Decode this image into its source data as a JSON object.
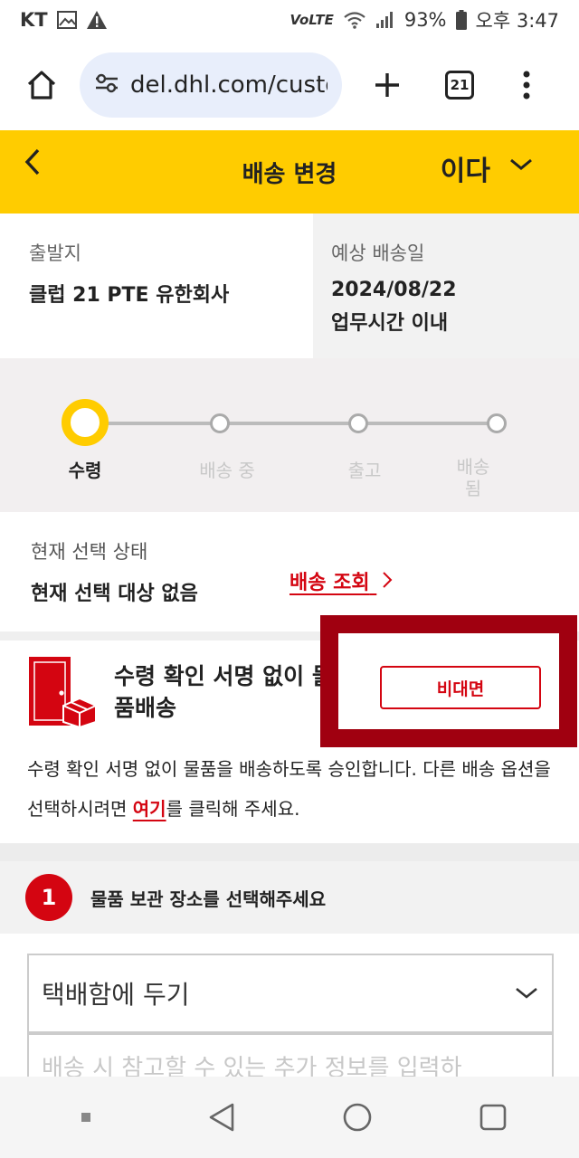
{
  "status_bar": {
    "carrier": "KT",
    "network": "VoLTE",
    "battery": "93%",
    "time": "오후 3:47"
  },
  "browser": {
    "url": "del.dhl.com/custo",
    "tab_count": "21"
  },
  "header": {
    "title": "배송 변경",
    "language": "이다"
  },
  "info": {
    "origin_label": "출발지",
    "origin_value": "클럽 21 PTE 유한회사",
    "eta_label": "예상 배송일",
    "eta_date": "2024/08/22",
    "eta_time": "업무시간 이내"
  },
  "progress": {
    "steps": [
      "수령",
      "배송 중",
      "출고",
      "배송 됨"
    ],
    "active_index": 0
  },
  "current": {
    "label": "현재 선택 상태",
    "value": "현재 선택 대상 없음",
    "track_link": "배송 조회"
  },
  "option": {
    "title": "수령 확인 서명 없이 물품배송",
    "button": "비대면",
    "desc_before": "수령 확인 서명 없이 물품을 배송하도록 승인합니다. 다른 배송 옵션을 선택하시려면 ",
    "desc_link": "여기",
    "desc_after": "를 클릭해 주세요."
  },
  "step1": {
    "number": "1",
    "title": "물품 보관 장소를 선택해주세요",
    "select_value": "택배함에 두기",
    "textarea_placeholder": "배송 시 참고할 수 있는 추가 정보를 입력하"
  },
  "colors": {
    "brand_yellow": "#ffcc00",
    "brand_red": "#d40511",
    "highlight_box": "#a00010"
  }
}
